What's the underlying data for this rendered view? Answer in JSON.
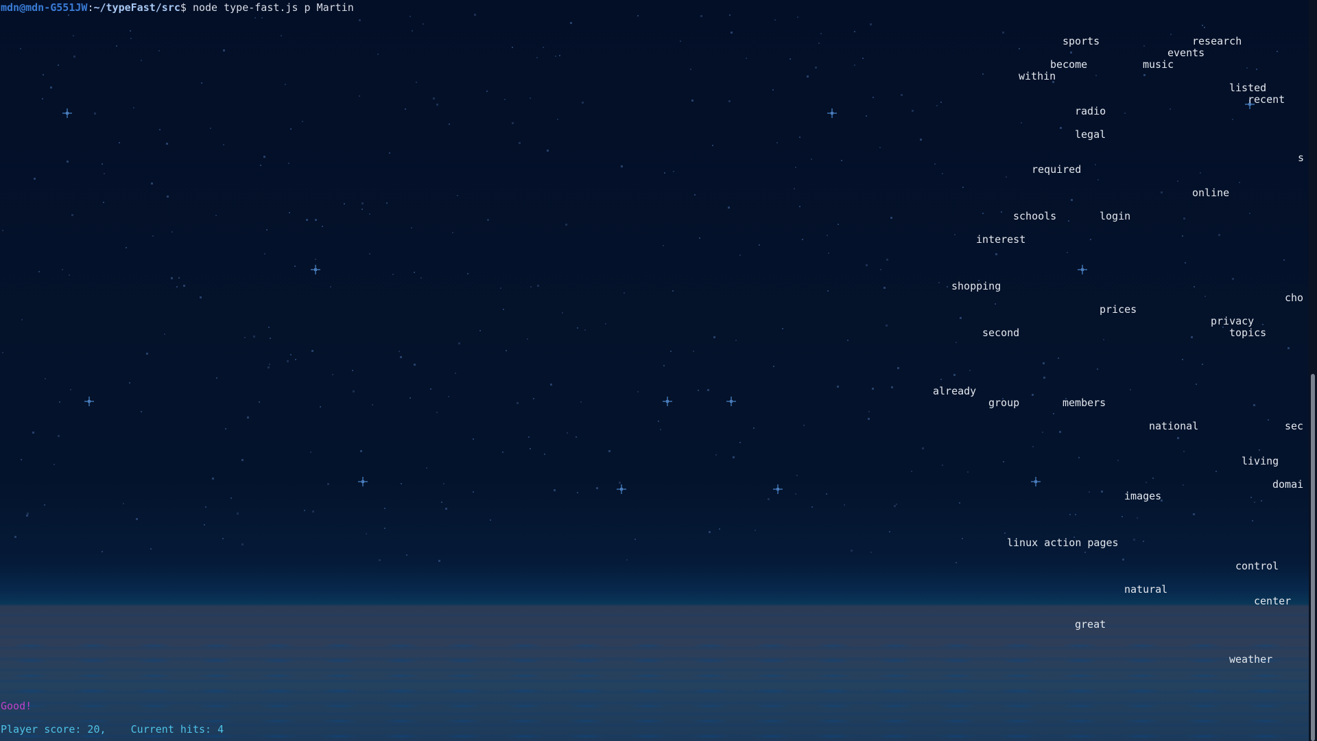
{
  "terminal": {
    "prompt_user_host": "mdn@mdn-G551JW",
    "prompt_sep": ":",
    "prompt_path": "~/typeFast/src",
    "prompt_symbol": "$ ",
    "command": "node type-fast.js p Martin"
  },
  "falling_words": [
    "sports",
    "research",
    "events",
    "become",
    "music",
    "within",
    "listed",
    "recent",
    "radio",
    "legal",
    "s",
    "required",
    "online",
    "schools",
    "login",
    "interest",
    "shopping",
    "cho",
    "prices",
    "privacy",
    "second",
    "topics",
    "already",
    "group",
    "members",
    "national",
    "sec",
    "living",
    "domai",
    "images",
    "linux action pages",
    "control",
    "natural",
    "center",
    "great",
    "weather"
  ],
  "status": {
    "feedback": "Good!",
    "score_line": "Player score: 20,    Current hits: 4"
  },
  "colors": {
    "background": "#031027",
    "prompt_user": "#3a7bd5",
    "prompt_path": "#a7c7f2",
    "feedback": "#c042c8",
    "score": "#4fc3e8"
  }
}
